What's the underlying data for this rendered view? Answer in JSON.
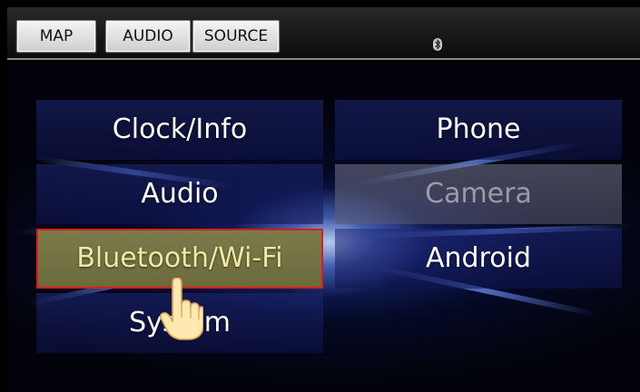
{
  "topbar": {
    "buttons": [
      "MAP",
      "AUDIO",
      "SOURCE"
    ]
  },
  "menu": {
    "items": [
      {
        "label": "Clock/Info",
        "state": "normal"
      },
      {
        "label": "Phone",
        "state": "normal"
      },
      {
        "label": "Audio",
        "state": "normal"
      },
      {
        "label": "Camera",
        "state": "disabled"
      },
      {
        "label": "Bluetooth/Wi-Fi",
        "state": "selected"
      },
      {
        "label": "Android",
        "state": "normal"
      },
      {
        "label": "System",
        "state": "normal"
      }
    ]
  },
  "icons": {
    "status": "bluetooth-icon",
    "pointer": "pointing-hand-icon"
  },
  "colors": {
    "selected_border": "#e01919",
    "selected_text": "#f1e9a2",
    "tile_text": "#ffffff",
    "disabled_text": "#9a9aa8"
  }
}
